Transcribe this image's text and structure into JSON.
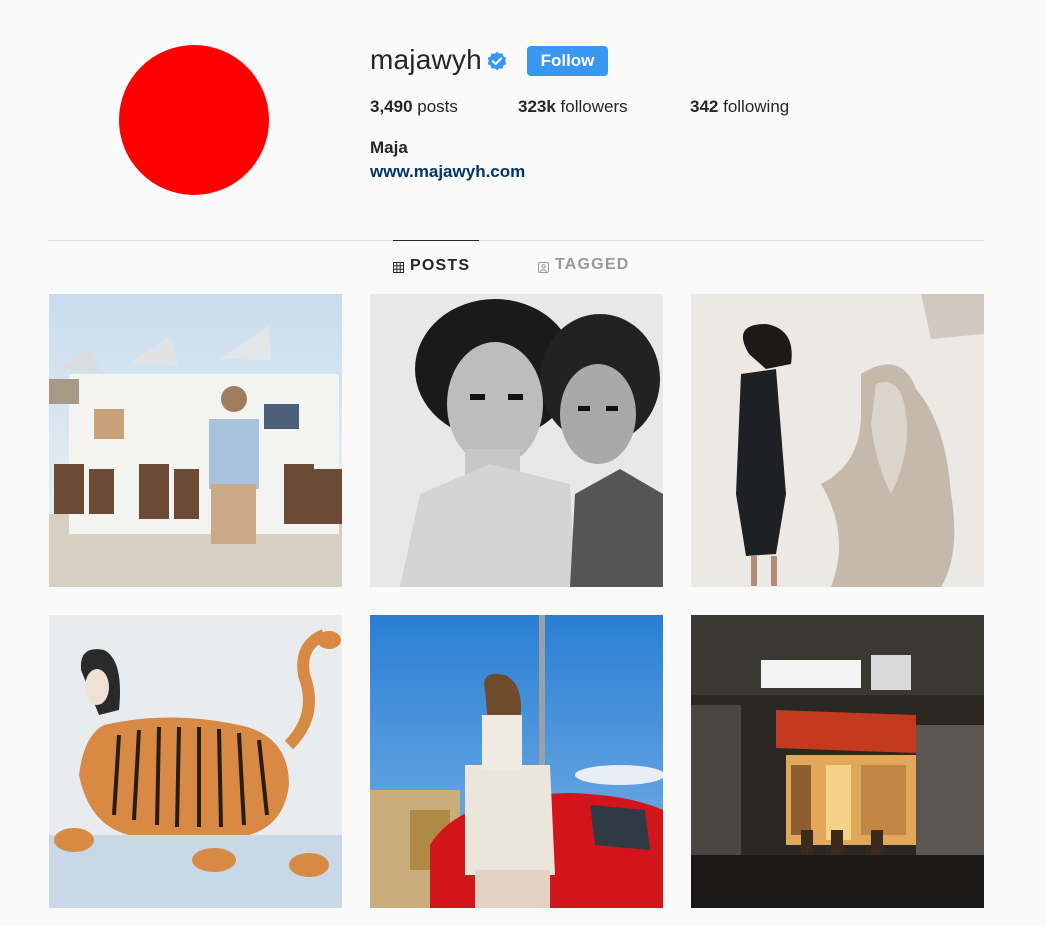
{
  "profile": {
    "username": "majawyh",
    "verified_icon": "verified-badge-icon",
    "follow_label": "Follow",
    "posts_count": "3,490",
    "posts_label": " posts",
    "followers_count": "323k",
    "followers_label": " followers",
    "following_count": "342",
    "following_label": " following",
    "full_name": "Maja",
    "website": "www.majawyh.com",
    "avatar_color": "#ff0000"
  },
  "tabs": [
    {
      "label": "POSTS",
      "icon": "grid-icon",
      "active": true
    },
    {
      "label": "TAGGED",
      "icon": "tagged-icon",
      "active": false
    }
  ],
  "colors": {
    "follow_button": "#3897f0",
    "verified": "#3897f0",
    "link": "#003569",
    "inactive_tab": "#999999"
  },
  "posts": [
    {
      "subject": "woman in denim shirt in front of white beach cabins"
    },
    {
      "subject": "black and white portrait of two young men"
    },
    {
      "subject": "woman in black dress beside marble statue"
    },
    {
      "subject": "painting of woman with tiger body"
    },
    {
      "subject": "woman in white track jacket by red car under blue sky"
    },
    {
      "subject": "night street cafe with red awning"
    }
  ]
}
